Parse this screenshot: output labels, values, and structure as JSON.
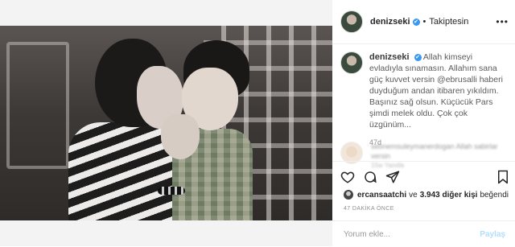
{
  "post": {
    "username": "denizseki",
    "follow_status": "Takiptesin",
    "separator": "•",
    "verified_mark": "✔",
    "more_icon": "•••"
  },
  "caption": {
    "username": "denizseki",
    "text": "Allah kimseyi evladıyla sınamasın. Allahım sana güç kuvvet versin @ebrusalli haberi duyduğum andan itibaren yıkıldım. Başınız sağ olsun. Küçücük Pars şimdi melek oldu. Çok çok üzgünüm...",
    "time": "47d"
  },
  "comment": {
    "text": "sebnemsuleymanerdogan Allah sabirlar versin",
    "meta": "15w   Yanıtla"
  },
  "actions": {
    "like_icon": "heart-icon",
    "comment_icon": "comment-icon",
    "share_icon": "paper-plane-icon",
    "save_icon": "bookmark-icon"
  },
  "likes": {
    "liker": "ercansaatchi",
    "conjunction": "ve",
    "others": "3.943 diğer kişi",
    "suffix": "beğendi"
  },
  "post_time": "47 DAKİKA ÖNCE",
  "comment_box": {
    "placeholder": "Yorum ekle...",
    "submit_label": "Paylaş"
  },
  "colors": {
    "verified": "#3897f0",
    "text": "#262626",
    "muted": "#8e8e8e",
    "submit_disabled": "#b2dffc"
  }
}
